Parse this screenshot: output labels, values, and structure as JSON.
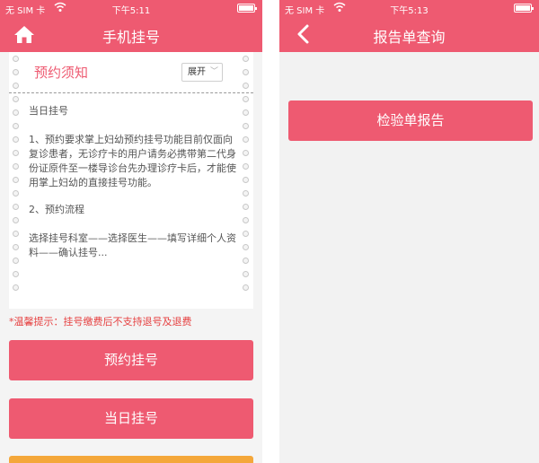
{
  "left_screen": {
    "status": {
      "carrier": "无 SIM 卡",
      "time": "下午5:11",
      "battery_level": 0.9
    },
    "navbar": {
      "title": "手机挂号",
      "home_icon": "home-icon"
    },
    "notice": {
      "title": "预约须知",
      "expand_label": "展开",
      "section_same_day": "当日挂号",
      "rule_1": "1、预约要求掌上妇幼预约挂号功能目前仅面向复诊患者，无诊疗卡的用户请务必携带第二代身份证原件至一楼导诊台先办理诊疗卡后，才能使用掌上妇幼的直接挂号功能。",
      "rule_2_title": "2、预约流程",
      "rule_2_steps": "选择挂号科室——选择医生——填写详细个人资料——确认挂号..."
    },
    "tip": "*温馨提示：挂号缴费后不支持退号及退费",
    "buttons": {
      "book": "预约挂号",
      "same_day": "当日挂号"
    }
  },
  "right_screen": {
    "status": {
      "carrier": "无 SIM 卡",
      "time": "下午5:13",
      "battery_level": 0.9
    },
    "navbar": {
      "title": "报告单查询",
      "back_icon": "chevron-left-icon"
    },
    "buttons": {
      "report": "检验单报告"
    }
  },
  "colors": {
    "accent": "#ee5a71",
    "tip": "#e64141",
    "orange": "#f4a73a"
  }
}
